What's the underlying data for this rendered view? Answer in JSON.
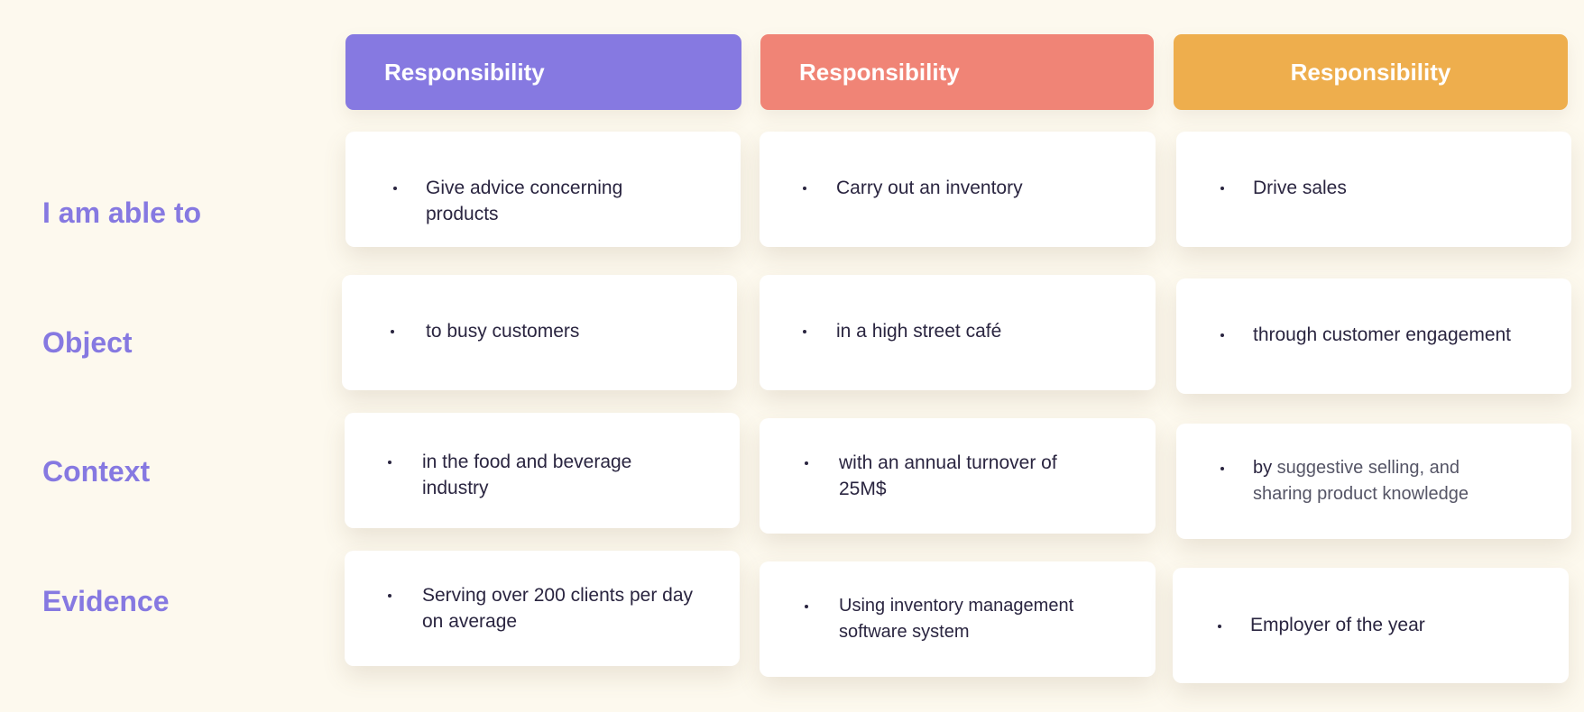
{
  "colors": {
    "background": "#fdf9ee",
    "accent_purple": "#8679e1",
    "accent_coral": "#f08476",
    "accent_orange": "#eeae4d",
    "card": "#ffffff",
    "text_dark": "#2a2540"
  },
  "columns": [
    {
      "header": "Responsibility",
      "color": "#8679e1"
    },
    {
      "header": "Responsibility",
      "color": "#f08476"
    },
    {
      "header": "Responsibility",
      "color": "#eeae4d"
    }
  ],
  "rows": [
    {
      "label": "I am able to",
      "cells": [
        "Give advice concerning products",
        "Carry out an inventory",
        "Drive sales"
      ]
    },
    {
      "label": "Object",
      "cells": [
        "to busy customers",
        "in a high street café",
        "through customer engagement"
      ]
    },
    {
      "label": "Context",
      "cells": [
        "in the food and beverage industry",
        "with an annual turnover of 25M$",
        {
          "lead": "by",
          "rest": " suggestive selling, and sharing product knowledge"
        }
      ]
    },
    {
      "label": "Evidence",
      "cells": [
        "Serving over 200 clients per day on average",
        "Using inventory management software system",
        "Employer of the year"
      ]
    }
  ],
  "bullet_icon": "dot-bullet-icon"
}
